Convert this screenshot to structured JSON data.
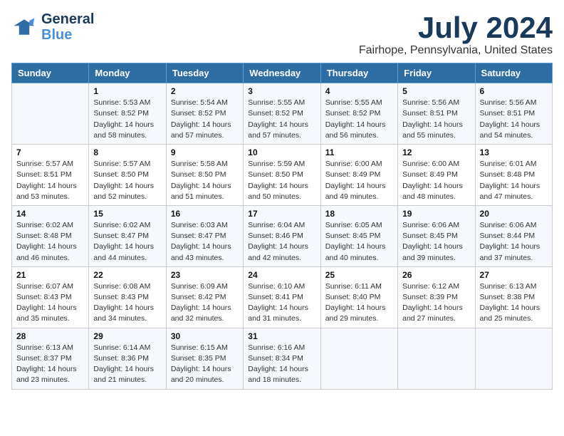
{
  "logo": {
    "line1": "General",
    "line2": "Blue"
  },
  "title": "July 2024",
  "subtitle": "Fairhope, Pennsylvania, United States",
  "weekdays": [
    "Sunday",
    "Monday",
    "Tuesday",
    "Wednesday",
    "Thursday",
    "Friday",
    "Saturday"
  ],
  "weeks": [
    [
      {
        "day": "",
        "sunrise": "",
        "sunset": "",
        "daylight": ""
      },
      {
        "day": "1",
        "sunrise": "Sunrise: 5:53 AM",
        "sunset": "Sunset: 8:52 PM",
        "daylight": "Daylight: 14 hours and 58 minutes."
      },
      {
        "day": "2",
        "sunrise": "Sunrise: 5:54 AM",
        "sunset": "Sunset: 8:52 PM",
        "daylight": "Daylight: 14 hours and 57 minutes."
      },
      {
        "day": "3",
        "sunrise": "Sunrise: 5:55 AM",
        "sunset": "Sunset: 8:52 PM",
        "daylight": "Daylight: 14 hours and 57 minutes."
      },
      {
        "day": "4",
        "sunrise": "Sunrise: 5:55 AM",
        "sunset": "Sunset: 8:52 PM",
        "daylight": "Daylight: 14 hours and 56 minutes."
      },
      {
        "day": "5",
        "sunrise": "Sunrise: 5:56 AM",
        "sunset": "Sunset: 8:51 PM",
        "daylight": "Daylight: 14 hours and 55 minutes."
      },
      {
        "day": "6",
        "sunrise": "Sunrise: 5:56 AM",
        "sunset": "Sunset: 8:51 PM",
        "daylight": "Daylight: 14 hours and 54 minutes."
      }
    ],
    [
      {
        "day": "7",
        "sunrise": "Sunrise: 5:57 AM",
        "sunset": "Sunset: 8:51 PM",
        "daylight": "Daylight: 14 hours and 53 minutes."
      },
      {
        "day": "8",
        "sunrise": "Sunrise: 5:57 AM",
        "sunset": "Sunset: 8:50 PM",
        "daylight": "Daylight: 14 hours and 52 minutes."
      },
      {
        "day": "9",
        "sunrise": "Sunrise: 5:58 AM",
        "sunset": "Sunset: 8:50 PM",
        "daylight": "Daylight: 14 hours and 51 minutes."
      },
      {
        "day": "10",
        "sunrise": "Sunrise: 5:59 AM",
        "sunset": "Sunset: 8:50 PM",
        "daylight": "Daylight: 14 hours and 50 minutes."
      },
      {
        "day": "11",
        "sunrise": "Sunrise: 6:00 AM",
        "sunset": "Sunset: 8:49 PM",
        "daylight": "Daylight: 14 hours and 49 minutes."
      },
      {
        "day": "12",
        "sunrise": "Sunrise: 6:00 AM",
        "sunset": "Sunset: 8:49 PM",
        "daylight": "Daylight: 14 hours and 48 minutes."
      },
      {
        "day": "13",
        "sunrise": "Sunrise: 6:01 AM",
        "sunset": "Sunset: 8:48 PM",
        "daylight": "Daylight: 14 hours and 47 minutes."
      }
    ],
    [
      {
        "day": "14",
        "sunrise": "Sunrise: 6:02 AM",
        "sunset": "Sunset: 8:48 PM",
        "daylight": "Daylight: 14 hours and 46 minutes."
      },
      {
        "day": "15",
        "sunrise": "Sunrise: 6:02 AM",
        "sunset": "Sunset: 8:47 PM",
        "daylight": "Daylight: 14 hours and 44 minutes."
      },
      {
        "day": "16",
        "sunrise": "Sunrise: 6:03 AM",
        "sunset": "Sunset: 8:47 PM",
        "daylight": "Daylight: 14 hours and 43 minutes."
      },
      {
        "day": "17",
        "sunrise": "Sunrise: 6:04 AM",
        "sunset": "Sunset: 8:46 PM",
        "daylight": "Daylight: 14 hours and 42 minutes."
      },
      {
        "day": "18",
        "sunrise": "Sunrise: 6:05 AM",
        "sunset": "Sunset: 8:45 PM",
        "daylight": "Daylight: 14 hours and 40 minutes."
      },
      {
        "day": "19",
        "sunrise": "Sunrise: 6:06 AM",
        "sunset": "Sunset: 8:45 PM",
        "daylight": "Daylight: 14 hours and 39 minutes."
      },
      {
        "day": "20",
        "sunrise": "Sunrise: 6:06 AM",
        "sunset": "Sunset: 8:44 PM",
        "daylight": "Daylight: 14 hours and 37 minutes."
      }
    ],
    [
      {
        "day": "21",
        "sunrise": "Sunrise: 6:07 AM",
        "sunset": "Sunset: 8:43 PM",
        "daylight": "Daylight: 14 hours and 35 minutes."
      },
      {
        "day": "22",
        "sunrise": "Sunrise: 6:08 AM",
        "sunset": "Sunset: 8:43 PM",
        "daylight": "Daylight: 14 hours and 34 minutes."
      },
      {
        "day": "23",
        "sunrise": "Sunrise: 6:09 AM",
        "sunset": "Sunset: 8:42 PM",
        "daylight": "Daylight: 14 hours and 32 minutes."
      },
      {
        "day": "24",
        "sunrise": "Sunrise: 6:10 AM",
        "sunset": "Sunset: 8:41 PM",
        "daylight": "Daylight: 14 hours and 31 minutes."
      },
      {
        "day": "25",
        "sunrise": "Sunrise: 6:11 AM",
        "sunset": "Sunset: 8:40 PM",
        "daylight": "Daylight: 14 hours and 29 minutes."
      },
      {
        "day": "26",
        "sunrise": "Sunrise: 6:12 AM",
        "sunset": "Sunset: 8:39 PM",
        "daylight": "Daylight: 14 hours and 27 minutes."
      },
      {
        "day": "27",
        "sunrise": "Sunrise: 6:13 AM",
        "sunset": "Sunset: 8:38 PM",
        "daylight": "Daylight: 14 hours and 25 minutes."
      }
    ],
    [
      {
        "day": "28",
        "sunrise": "Sunrise: 6:13 AM",
        "sunset": "Sunset: 8:37 PM",
        "daylight": "Daylight: 14 hours and 23 minutes."
      },
      {
        "day": "29",
        "sunrise": "Sunrise: 6:14 AM",
        "sunset": "Sunset: 8:36 PM",
        "daylight": "Daylight: 14 hours and 21 minutes."
      },
      {
        "day": "30",
        "sunrise": "Sunrise: 6:15 AM",
        "sunset": "Sunset: 8:35 PM",
        "daylight": "Daylight: 14 hours and 20 minutes."
      },
      {
        "day": "31",
        "sunrise": "Sunrise: 6:16 AM",
        "sunset": "Sunset: 8:34 PM",
        "daylight": "Daylight: 14 hours and 18 minutes."
      },
      {
        "day": "",
        "sunrise": "",
        "sunset": "",
        "daylight": ""
      },
      {
        "day": "",
        "sunrise": "",
        "sunset": "",
        "daylight": ""
      },
      {
        "day": "",
        "sunrise": "",
        "sunset": "",
        "daylight": ""
      }
    ]
  ]
}
